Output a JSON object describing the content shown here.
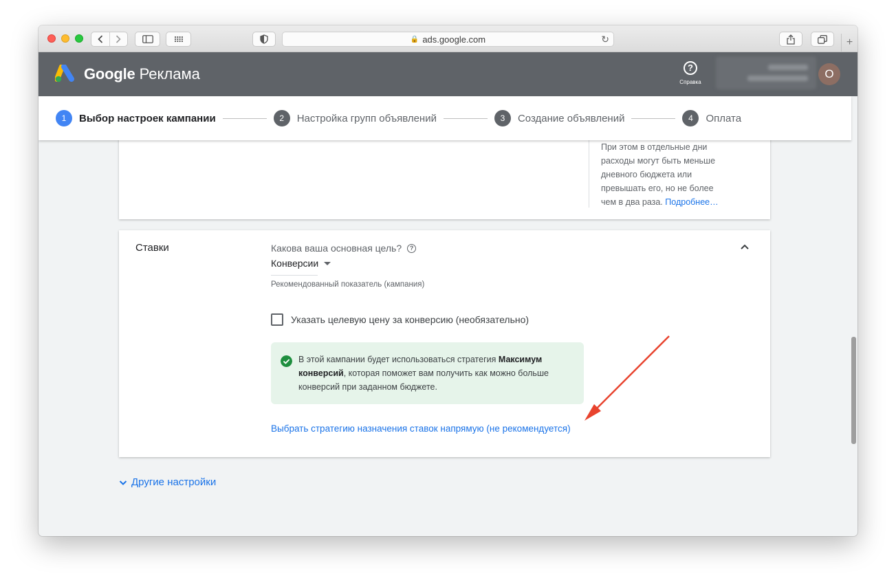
{
  "browser": {
    "url": "ads.google.com"
  },
  "header": {
    "brand_google": "Google",
    "brand_product": "Реклама",
    "help_label": "Справка",
    "avatar_letter": "O"
  },
  "stepper": {
    "steps": [
      {
        "number": "1",
        "label": "Выбор настроек кампании"
      },
      {
        "number": "2",
        "label": "Настройка групп объявлений"
      },
      {
        "number": "3",
        "label": "Создание объявлений"
      },
      {
        "number": "4",
        "label": "Оплата"
      }
    ]
  },
  "budget_card": {
    "note": "При этом в отдельные дни расходы могут быть меньше дневного бюджета или превышать его, но не более чем в два раза.",
    "more_link": "Подробнее…"
  },
  "bids_card": {
    "title": "Ставки",
    "goal_question": "Какова ваша основная цель?",
    "goal_value": "Конверсии",
    "goal_hint": "Рекомендованный показатель (кампания)",
    "target_checkbox_label": "Указать целевую цену за конверсию (необязательно)",
    "target_checkbox_checked": false,
    "info_prefix": "В этой кампании будет использоваться стратегия ",
    "info_bold": "Максимум конверсий",
    "info_suffix": ", которая поможет вам получить как можно больше конверсий при заданном бюджете.",
    "select_strategy_link": "Выбрать стратегию назначения ставок напрямую (не рекомендуется)"
  },
  "other_settings": {
    "label": "Другие настройки"
  },
  "colors": {
    "header_bg": "#5f6368",
    "accent_blue": "#1a73e8",
    "success_green": "#1e8e3e",
    "info_bg": "#e6f4ea",
    "annotation_arrow": "#e8432e"
  }
}
